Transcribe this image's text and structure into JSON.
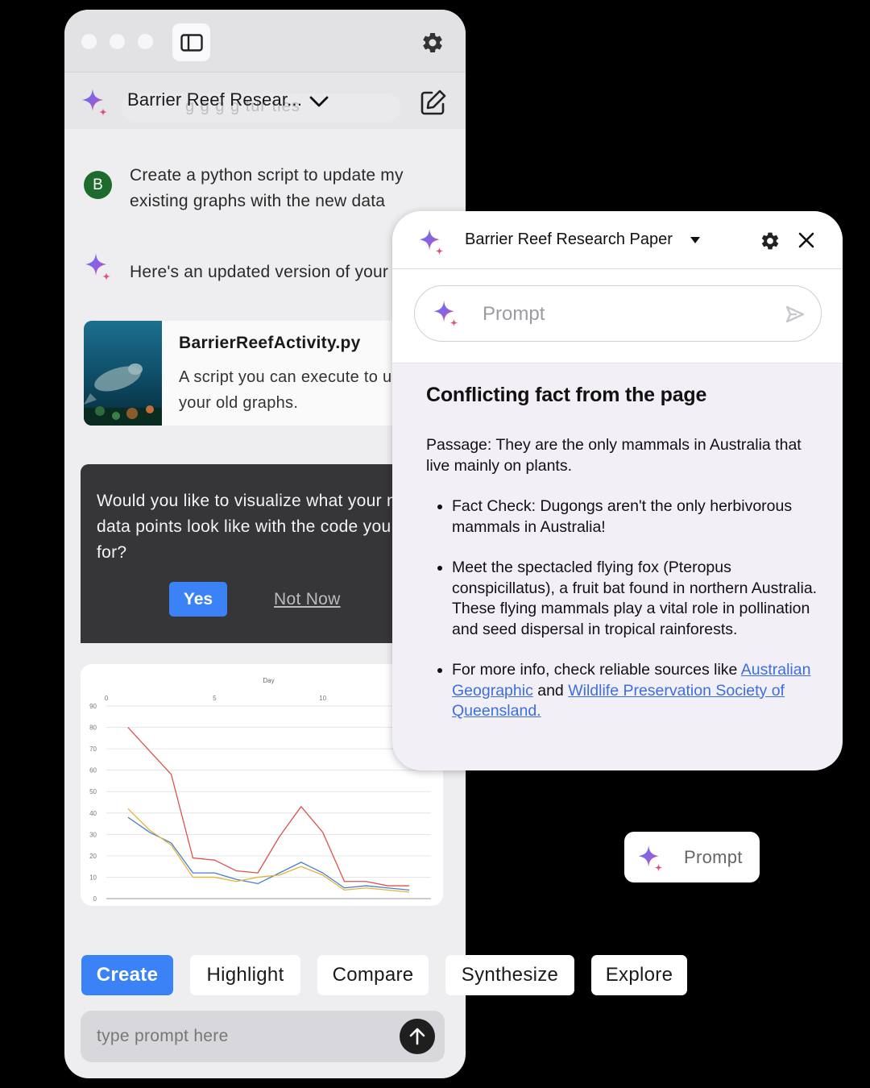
{
  "main_window": {
    "conversation_title": "Barrier Reef Resear...",
    "ghost_suggestion": "g g   g   g  tur tles",
    "user_avatar_initial": "B",
    "user_message": "Create a python script to update my existing graphs with the new data",
    "ai_message": "Here's an updated version of your graphs:",
    "file_card": {
      "name": "BarrierReefActivity.py",
      "description": "A script you can execute to update your old graphs."
    },
    "dialog": {
      "text": "Would you like to visualize what your new data points look like with the code you asked for?",
      "yes_label": "Yes",
      "not_now_label": "Not Now"
    },
    "chips": [
      "Create",
      "Highlight",
      "Compare",
      "Synthesize",
      "Explore"
    ],
    "prompt_placeholder": "type prompt here"
  },
  "panel": {
    "title": "Barrier Reef Research Paper",
    "prompt_placeholder": "Prompt",
    "heading": "Conflicting fact from the page",
    "passage": "Passage: They are the only mammals in Australia that live mainly on plants.",
    "bullets": {
      "fact_check": "Fact Check: Dugongs aren't the only herbivorous mammals in Australia!",
      "meet": "Meet the spectacled flying fox (Pteropus conspicillatus), a fruit bat found in northern Australia. These flying mammals play a vital role in pollination and seed dispersal in tropical rainforests.",
      "more_info_prefix": "For more info, check reliable sources like ",
      "link_1": "Australian Geographic",
      "and_word": " and ",
      "link_2": "Wildlife Preservation Society of Queensland."
    }
  },
  "mini_prompt": {
    "label": "Prompt"
  },
  "colors": {
    "accent_blue": "#3b82f6",
    "avatar_green": "#1e6b2e",
    "dialog_bg": "#363638",
    "panel_bg": "#f3eff6",
    "link_blue": "#3b6fe0"
  },
  "icons": [
    "sidebar-toggle-icon",
    "gear-icon",
    "sparkle-icon",
    "chevron-down-icon",
    "edit-icon",
    "send-icon",
    "arrow-up-icon",
    "close-icon",
    "caret-down-icon"
  ],
  "chart_data": {
    "type": "line",
    "title": "",
    "xlabel": "Day",
    "ylabel": "",
    "xlim": [
      0,
      15
    ],
    "ylim": [
      0,
      90
    ],
    "x_ticks": [
      0,
      5,
      10
    ],
    "y_ticks": [
      0,
      10,
      20,
      30,
      40,
      50,
      60,
      70,
      80,
      90
    ],
    "grid": true,
    "x": [
      1,
      2,
      3,
      4,
      5,
      6,
      7,
      8,
      9,
      10,
      11,
      12,
      13,
      14
    ],
    "series": [
      {
        "color": "#d9534f",
        "values": [
          80,
          69,
          58,
          19,
          18,
          13,
          12,
          29,
          43,
          31,
          8,
          8,
          6,
          6
        ]
      },
      {
        "color": "#4a7ecf",
        "values": [
          38,
          31,
          26,
          12,
          12,
          9,
          7,
          12,
          17,
          12,
          5,
          6,
          5,
          4
        ]
      },
      {
        "color": "#e0b53a",
        "values": [
          42,
          32,
          25,
          10,
          10,
          8,
          10,
          11,
          15,
          11,
          4,
          5,
          4,
          3
        ]
      }
    ]
  }
}
